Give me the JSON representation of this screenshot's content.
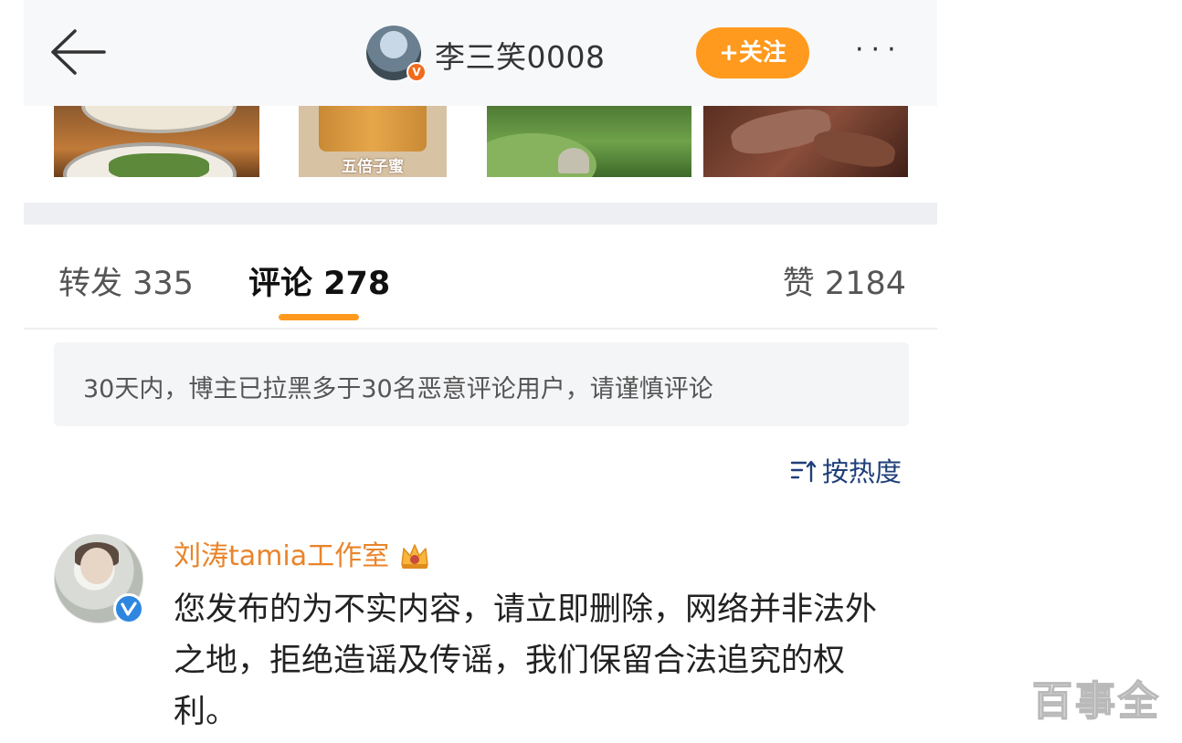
{
  "header": {
    "username": "李三笑0008",
    "follow_label": "+关注",
    "more_label": "···"
  },
  "photos": {
    "jar_label": "五倍子蜜"
  },
  "tabs": {
    "repost": "转发 335",
    "comment": "评论 278",
    "like": "赞 2184"
  },
  "notice": "30天内，博主已拉黑多于30名恶意评论用户，请谨慎评论",
  "sort_label": "按热度",
  "comment": {
    "author": "刘涛tamia工作室",
    "text": "您发布的为不实内容，请立即删除，网络并非法外之地，拒绝造谣及传谣，我们保留合法追究的权利。"
  },
  "watermark": "百事全",
  "colors": {
    "accent": "#ff9a1f",
    "author_name": "#e9842a",
    "sort_text": "#1f3f7a",
    "verified": "#2d86e0"
  }
}
